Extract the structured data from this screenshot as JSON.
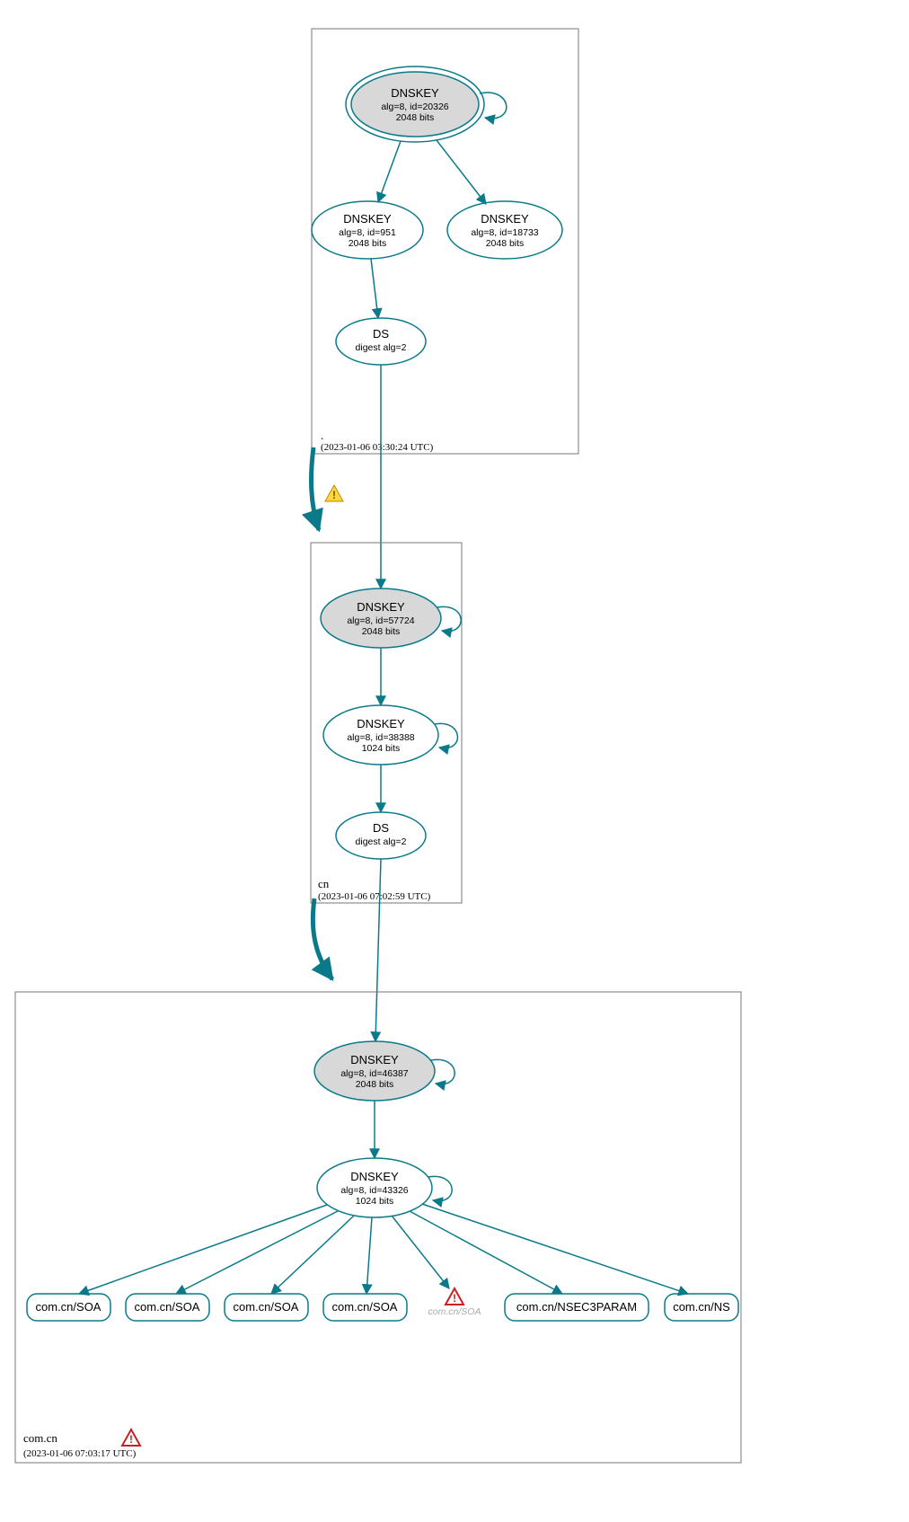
{
  "zones": [
    {
      "name": ".",
      "timestamp": "(2023-01-06 03:30:24 UTC)"
    },
    {
      "name": "cn",
      "timestamp": "(2023-01-06 07:02:59 UTC)"
    },
    {
      "name": "com.cn",
      "timestamp": "(2023-01-06 07:03:17 UTC)"
    }
  ],
  "nodes": {
    "root_ksk": {
      "title": "DNSKEY",
      "l2": "alg=8, id=20326",
      "l3": "2048 bits"
    },
    "root_zsk1": {
      "title": "DNSKEY",
      "l2": "alg=8, id=951",
      "l3": "2048 bits"
    },
    "root_zsk2": {
      "title": "DNSKEY",
      "l2": "alg=8, id=18733",
      "l3": "2048 bits"
    },
    "root_ds": {
      "title": "DS",
      "l2": "digest alg=2"
    },
    "cn_ksk": {
      "title": "DNSKEY",
      "l2": "alg=8, id=57724",
      "l3": "2048 bits"
    },
    "cn_zsk": {
      "title": "DNSKEY",
      "l2": "alg=8, id=38388",
      "l3": "1024 bits"
    },
    "cn_ds": {
      "title": "DS",
      "l2": "digest alg=2"
    },
    "comcn_ksk": {
      "title": "DNSKEY",
      "l2": "alg=8, id=46387",
      "l3": "2048 bits"
    },
    "comcn_zsk": {
      "title": "DNSKEY",
      "l2": "alg=8, id=43326",
      "l3": "1024 bits"
    }
  },
  "rr": {
    "soa": "com.cn/SOA",
    "soa_bogus": "com.cn/SOA",
    "nsec3": "com.cn/NSEC3PARAM",
    "ns": "com.cn/NS"
  }
}
